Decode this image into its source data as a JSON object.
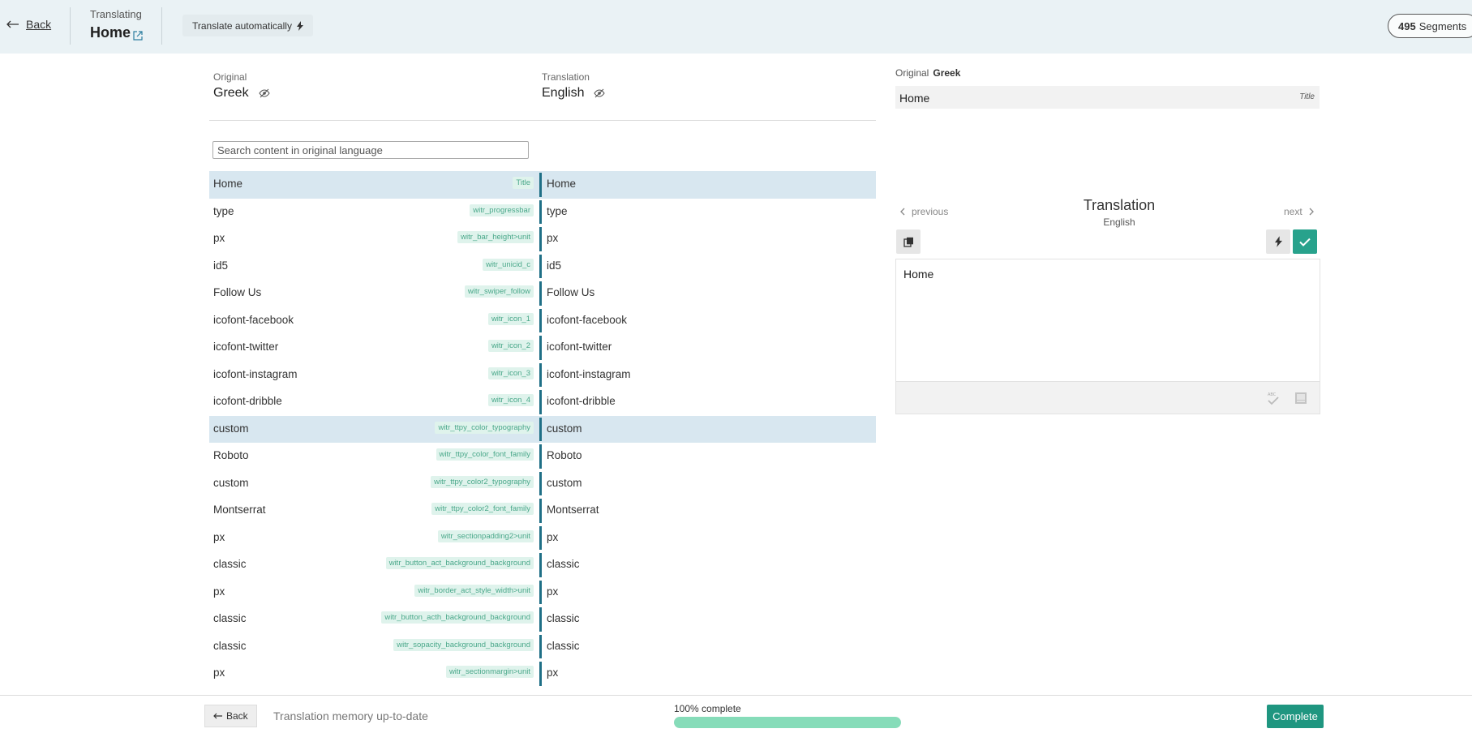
{
  "header": {
    "back_label": "Back",
    "translating_label": "Translating",
    "page_name": "Home",
    "auto_translate_label": "Translate automatically",
    "segments_count": "495",
    "segments_label": "Segments"
  },
  "languages": {
    "original_caption": "Original",
    "original_name": "Greek",
    "translation_caption": "Translation",
    "translation_name": "English"
  },
  "search": {
    "placeholder": "Search content in original language"
  },
  "segments": [
    {
      "original": "Home",
      "key": "Title",
      "translation": "Home",
      "selected": true
    },
    {
      "original": "type",
      "key": "witr_progressbar",
      "translation": "type"
    },
    {
      "original": "px",
      "key": "witr_bar_height>unit",
      "translation": "px"
    },
    {
      "original": "id5",
      "key": "witr_unicid_c",
      "translation": "id5"
    },
    {
      "original": "Follow Us",
      "key": "witr_swiper_follow",
      "translation": "Follow Us"
    },
    {
      "original": "icofont-facebook",
      "key": "witr_icon_1",
      "translation": "icofont-facebook"
    },
    {
      "original": "icofont-twitter",
      "key": "witr_icon_2",
      "translation": "icofont-twitter"
    },
    {
      "original": "icofont-instagram",
      "key": "witr_icon_3",
      "translation": "icofont-instagram"
    },
    {
      "original": "icofont-dribble",
      "key": "witr_icon_4",
      "translation": "icofont-dribble"
    },
    {
      "original": "custom",
      "key": "witr_ttpy_color_typography",
      "translation": "custom",
      "selected": true
    },
    {
      "original": "Roboto",
      "key": "witr_ttpy_color_font_family",
      "translation": "Roboto"
    },
    {
      "original": "custom",
      "key": "witr_ttpy_color2_typography",
      "translation": "custom"
    },
    {
      "original": "Montserrat",
      "key": "witr_ttpy_color2_font_family",
      "translation": "Montserrat"
    },
    {
      "original": "px",
      "key": "witr_sectionpadding2>unit",
      "translation": "px"
    },
    {
      "original": "classic",
      "key": "witr_button_act_background_background",
      "translation": "classic"
    },
    {
      "original": "px",
      "key": "witr_border_act_style_width>unit",
      "translation": "px"
    },
    {
      "original": "classic",
      "key": "witr_button_acth_background_background",
      "translation": "classic"
    },
    {
      "original": "classic",
      "key": "witr_sopacity_background_background",
      "translation": "classic"
    },
    {
      "original": "px",
      "key": "witr_sectionmargin>unit",
      "translation": "px"
    }
  ],
  "panel": {
    "original_caption": "Original",
    "original_lang": "Greek",
    "original_text": "Home",
    "original_tag": "Title",
    "previous_label": "previous",
    "next_label": "next",
    "translation_title": "Translation",
    "translation_lang": "English",
    "translation_text": "Home"
  },
  "footer": {
    "back_label": "Back",
    "status": "Translation memory up-to-date",
    "progress_label": "100% complete",
    "progress_fraction": 1.0,
    "complete_label": "Complete"
  },
  "colors": {
    "header_bg": "#eaf2f5",
    "accent": "#1f9680",
    "selected_row": "#d8e7f0",
    "key_tag": "#dff3ec",
    "progress_fill": "#86dcb9"
  }
}
